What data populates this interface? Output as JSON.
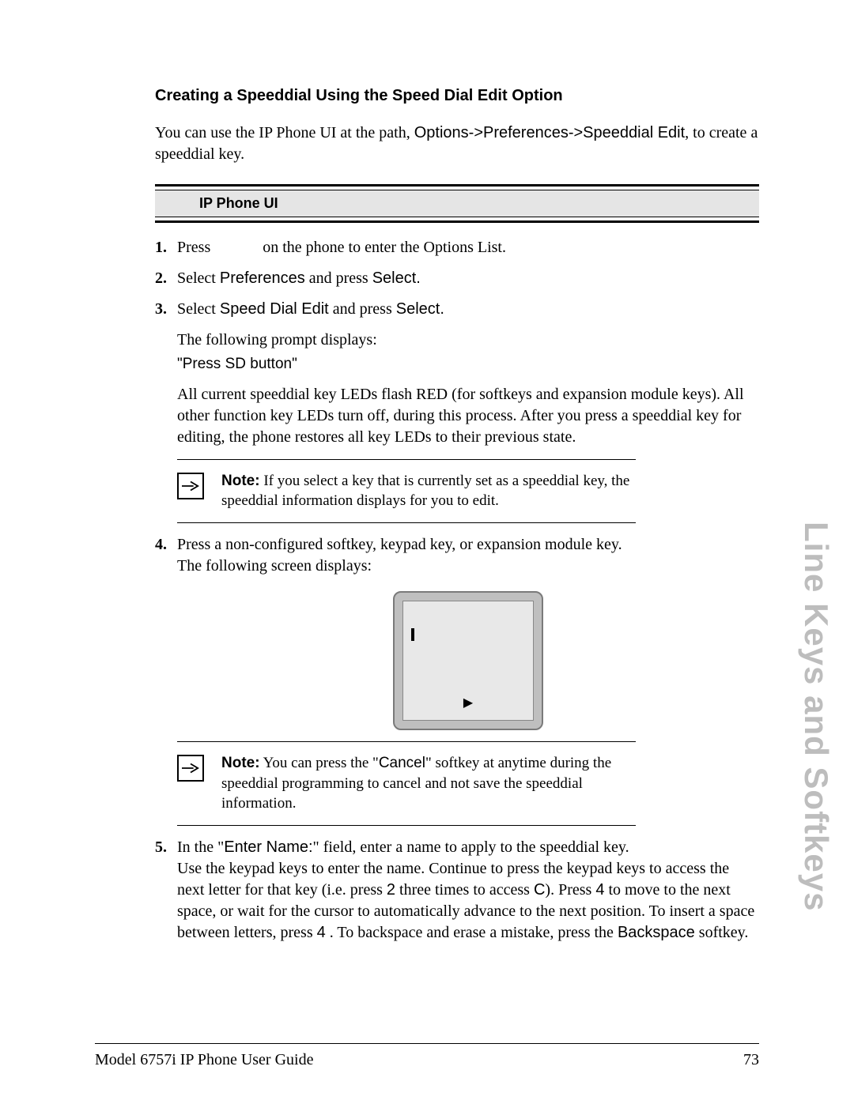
{
  "heading": "Creating a Speeddial Using the Speed Dial Edit Option",
  "intro_a": "You can use the IP Phone UI at the path, ",
  "intro_b_sans": "Options->Preferences->Speeddial Edit",
  "intro_c": ", to create a speeddial key.",
  "ui_header": "IP Phone UI",
  "step1_a": "Press ",
  "step1_b": " on the phone to enter the Options List.",
  "step2_a": "Select ",
  "step2_b_sans": "Preferences",
  "step2_c": " and press ",
  "step2_d_sans": "Select.",
  "step3_a": "Select ",
  "step3_b_sans": "Speed Dial Edit",
  "step3_c": " and press ",
  "step3_d_sans": "Select.",
  "step3_sub1": "The following prompt displays:",
  "step3_prompt": "\"Press SD button\"",
  "step3_sub2": "All current speeddial key LEDs flash RED (for softkeys and expansion module keys). All other function key LEDs turn off, during this process. After you press a speeddial key for editing, the phone restores all key LEDs to their previous state.",
  "note1_label": "Note:",
  "note1_body": " If you select a key that is currently set as a speeddial key, the speeddial information displays for you to edit.",
  "step4_a": "Press a non-configured softkey, keypad key, or expansion module key.",
  "step4_b": "The following screen displays:",
  "note2_label": "Note:",
  "note2_a": " You can press the \"",
  "note2_b_sans": "Cancel",
  "note2_c": "\" softkey at anytime during the speeddial programming to cancel and not save the speeddial information.",
  "step5_a": "In the \"",
  "step5_b_sans": "Enter Name:",
  "step5_c": "\" field, enter a name to apply to the speeddial key.",
  "step5_d": "Use the keypad keys to enter the name. Continue to press the keypad keys to access the next letter for that key (i.e. press ",
  "step5_key2": "2",
  "step5_e": " three times to access ",
  "step5_keyC": "C",
  "step5_f": "). Press ",
  "step5_key4a": "4",
  "step5_g": " to move to the next space, or wait for the cursor to automatically advance to the next position. To insert a space between letters, press ",
  "step5_key4b": "4",
  "step5_h": " . To backspace and erase a mistake, press the ",
  "step5_backspace": "Backspace",
  "step5_i": " softkey.",
  "side_tab": "Line Keys and Softkeys",
  "footer_left": "Model 6757i IP Phone User Guide",
  "footer_right": "73"
}
